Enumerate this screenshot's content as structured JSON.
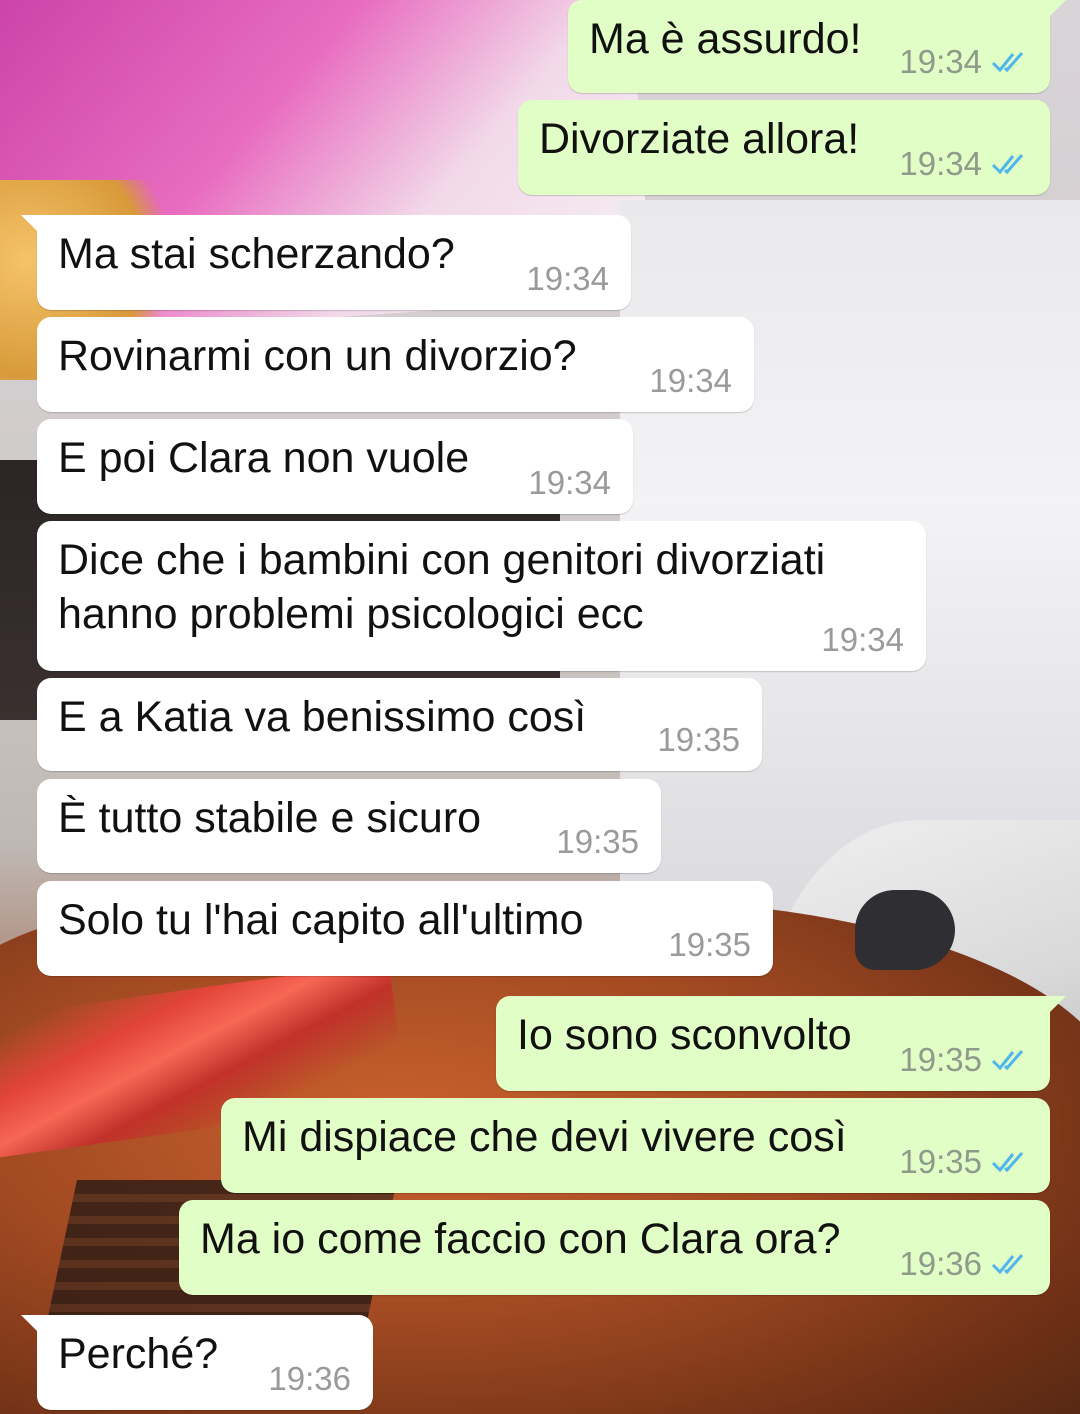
{
  "colors": {
    "outgoing_bubble": "#e1fec6",
    "incoming_bubble": "#ffffff",
    "read_ticks": "#4fb6ec"
  },
  "messages": [
    {
      "dir": "out",
      "text": "Ma è assurdo!",
      "time": "19:34",
      "status_icon": "double-check-read-icon"
    },
    {
      "dir": "out",
      "text": "Divorziate allora!",
      "time": "19:34",
      "status_icon": "double-check-read-icon"
    },
    {
      "dir": "in",
      "text": "Ma stai scherzando?",
      "time": "19:34"
    },
    {
      "dir": "in",
      "text": "Rovinarmi con un divorzio?",
      "time": "19:34"
    },
    {
      "dir": "in",
      "text": "E poi Clara non vuole",
      "time": "19:34"
    },
    {
      "dir": "in",
      "text": "Dice che i bambini con genitori divorziati\nhanno problemi psicologici ecc",
      "time": "19:34"
    },
    {
      "dir": "in",
      "text": "E a Katia va benissimo così",
      "time": "19:35"
    },
    {
      "dir": "in",
      "text": "È tutto stabile e sicuro",
      "time": "19:35"
    },
    {
      "dir": "in",
      "text": "Solo tu l'hai capito all'ultimo",
      "time": "19:35"
    },
    {
      "dir": "out",
      "text": "Io sono sconvolto",
      "time": "19:35",
      "status_icon": "double-check-read-icon"
    },
    {
      "dir": "out",
      "text": "Mi dispiace che devi vivere così",
      "time": "19:35",
      "status_icon": "double-check-read-icon"
    },
    {
      "dir": "out",
      "text": "Ma io come faccio con Clara ora?",
      "time": "19:36",
      "status_icon": "double-check-read-icon"
    },
    {
      "dir": "in",
      "text": "Perché?",
      "time": "19:36"
    }
  ]
}
